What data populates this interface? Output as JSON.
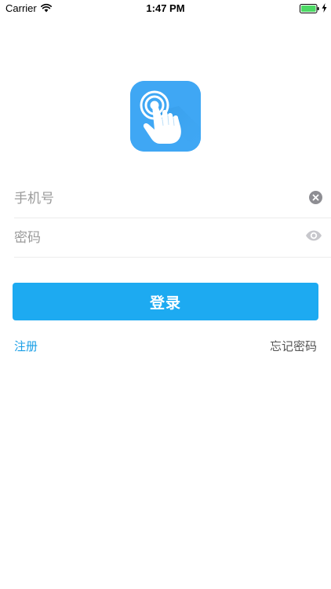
{
  "status_bar": {
    "carrier": "Carrier",
    "time": "1:47 PM",
    "battery_color": "#4cd964"
  },
  "app_icon": {
    "name": "hand-tap-icon",
    "background": "#3fa7f4"
  },
  "form": {
    "phone": {
      "placeholder": "手机号",
      "value": "",
      "trailing_icon": "clear-icon"
    },
    "password": {
      "placeholder": "密码",
      "value": "",
      "trailing_icon": "eye-icon"
    }
  },
  "actions": {
    "login_label": "登录",
    "register_label": "注册",
    "forgot_password_label": "忘记密码"
  },
  "colors": {
    "accent": "#1daaf1",
    "link": "#1a9fe6"
  }
}
